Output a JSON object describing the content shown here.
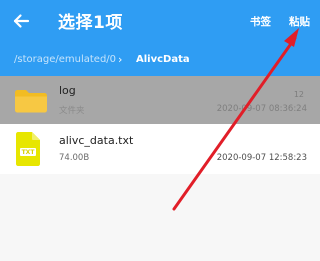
{
  "header": {
    "title": "选择1项",
    "bookmark_label": "书签",
    "paste_label": "粘贴"
  },
  "path": {
    "root": "/storage/emulated/0",
    "current": "AlivcData"
  },
  "items": [
    {
      "name": "log",
      "subtitle": "文件夹",
      "count": "12",
      "date": "2020-09-07 08:36:24"
    },
    {
      "name": "alivc_data.txt",
      "size": "74.00B",
      "date": "2020-09-07 12:58:23",
      "file_badge": "TXT"
    }
  ],
  "colors": {
    "header_background": "#2f9df3",
    "selected_row_background": "#a7a7a7",
    "folder_yellow": "#f2bc22",
    "txt_icon_yellow": "#e7e600",
    "annotation_arrow": "#e11e28"
  },
  "icons": {
    "back": "arrow-left-icon",
    "path_separator": "chevron-right-icon",
    "folder": "folder-icon",
    "txt_file": "txt-file-icon"
  }
}
